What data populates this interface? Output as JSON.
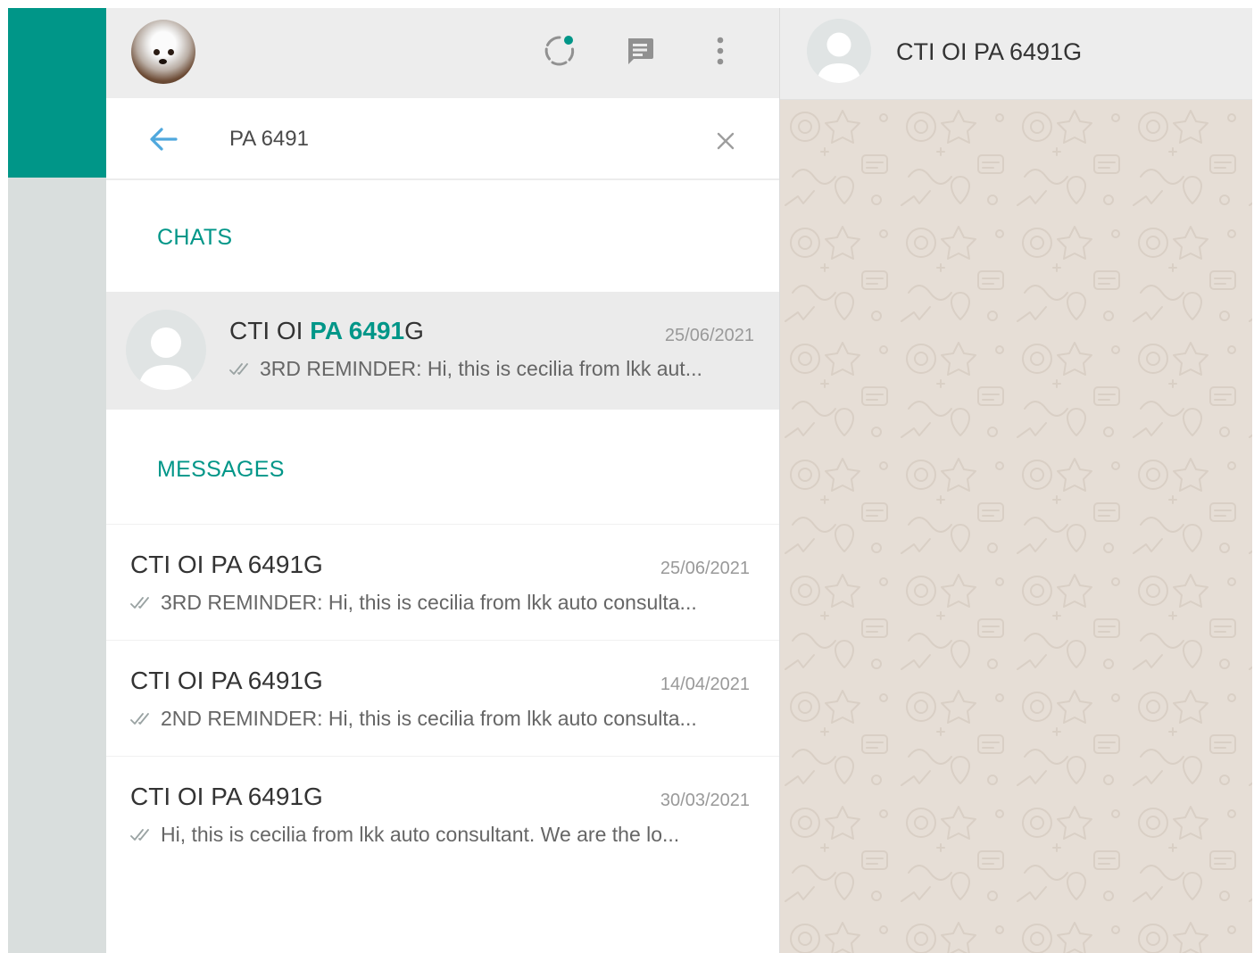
{
  "colors": {
    "accent": "#009688",
    "header_bg": "#ededed",
    "wallpaper": "#e6ded6",
    "icon_gray": "#919191",
    "back_blue": "#4fa8dd"
  },
  "sidebar": {
    "header": {
      "icons": [
        "status-icon",
        "new-chat-icon",
        "menu-icon"
      ]
    },
    "search": {
      "value": "PA 6491",
      "back_icon": "arrow-left-icon",
      "clear_icon": "close-icon"
    },
    "chats_label": "CHATS",
    "chat_result": {
      "name_prefix": "CTI OI ",
      "name_highlight": "PA 6491",
      "name_suffix": "G",
      "date": "25/06/2021",
      "preview": "3RD REMINDER: Hi,  this is cecilia from lkk aut..."
    },
    "messages_label": "MESSAGES",
    "messages": [
      {
        "name": "CTI OI PA 6491G",
        "date": "25/06/2021",
        "preview": "3RD REMINDER: Hi,  this is cecilia from lkk auto consulta..."
      },
      {
        "name": "CTI OI PA 6491G",
        "date": "14/04/2021",
        "preview": "2ND REMINDER: Hi,  this is cecilia from lkk auto consulta..."
      },
      {
        "name": "CTI OI PA 6491G",
        "date": "30/03/2021",
        "preview": "Hi,  this is cecilia from lkk auto consultant.  We are the lo..."
      }
    ]
  },
  "conversation": {
    "title": "CTI OI PA 6491G"
  }
}
